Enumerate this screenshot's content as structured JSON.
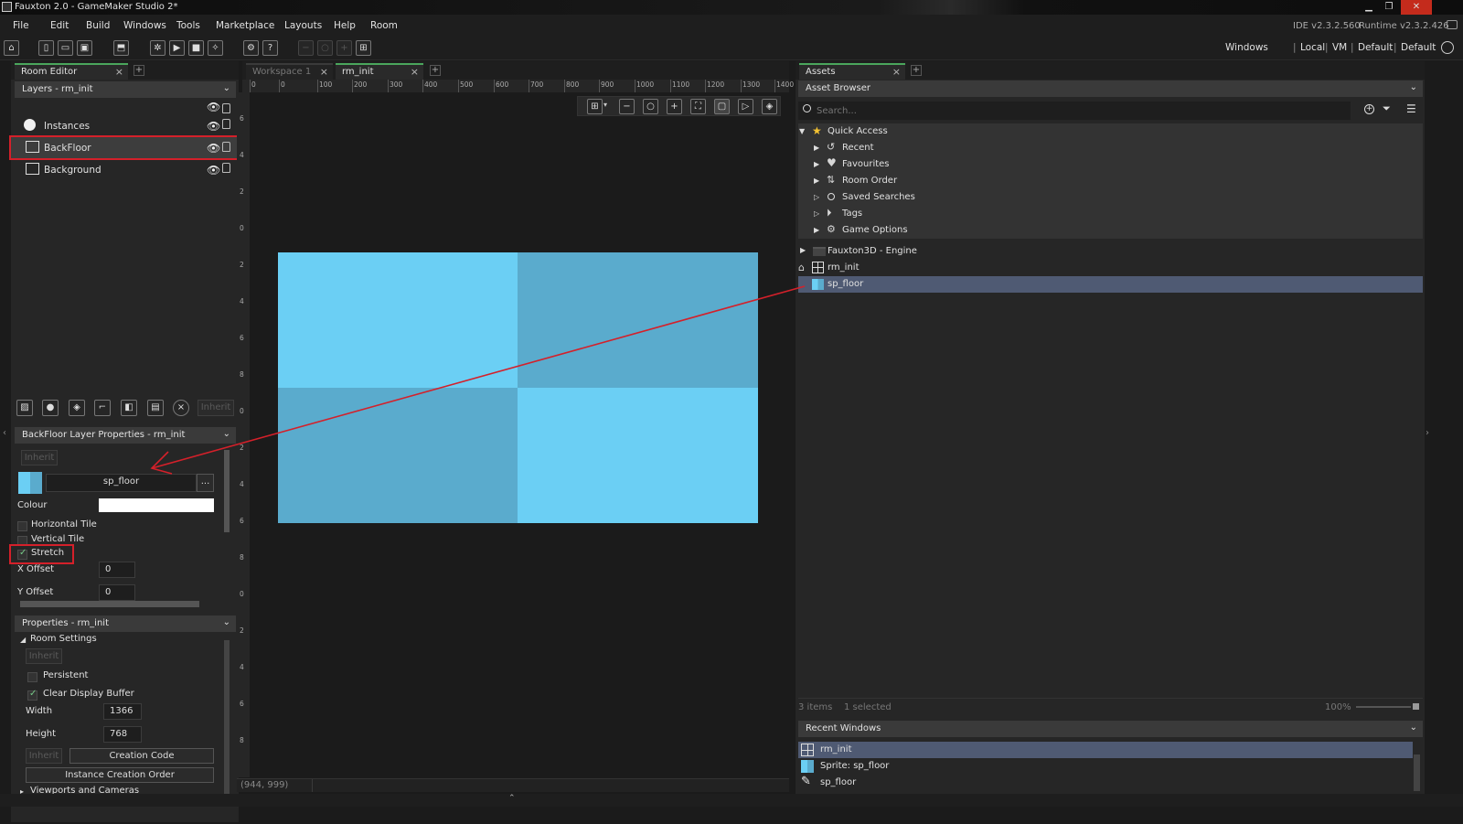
{
  "window": {
    "title": "Fauxton 2.0 - GameMaker Studio 2*"
  },
  "menu": [
    "File",
    "Edit",
    "Build",
    "Windows",
    "Tools",
    "Marketplace",
    "Layouts",
    "Help",
    "Room"
  ],
  "versions": {
    "ide": "IDE v2.3.2.560",
    "runtime": "Runtime v2.3.2.426"
  },
  "targets": [
    "Windows",
    "Local",
    "VM",
    "Default",
    "Default"
  ],
  "separator": "|",
  "room_editor": {
    "tab": "Room Editor",
    "layers_header": "Layers - rm_init",
    "layers": [
      {
        "name": "Instances",
        "icon": "instance-layer-icon"
      },
      {
        "name": "BackFloor",
        "icon": "background-layer-icon",
        "selected": true
      },
      {
        "name": "Background",
        "icon": "background-layer-icon"
      }
    ],
    "inherit_label": "Inherit",
    "layer_props": {
      "header": "BackFloor Layer Properties - rm_init",
      "inherit": "Inherit",
      "sprite": "sp_floor",
      "sprite_btn": "...",
      "colour_label": "Colour",
      "colour": "#ffffff",
      "horizontal_tile": "Horizontal Tile",
      "vertical_tile": "Vertical Tile",
      "stretch": "Stretch",
      "x_offset_label": "X Offset",
      "x_offset": "0",
      "y_offset_label": "Y Offset",
      "y_offset": "0"
    },
    "room_props": {
      "header": "Properties - rm_init",
      "section": "Room Settings",
      "inherit": "Inherit",
      "persistent": "Persistent",
      "clear_display": "Clear Display Buffer",
      "width_label": "Width",
      "width": "1366",
      "height_label": "Height",
      "height": "768",
      "inherit2": "Inherit",
      "creation_code": "Creation Code",
      "instance_order": "Instance Creation Order",
      "viewports": "Viewports and Cameras"
    }
  },
  "workspace": {
    "tabs": [
      {
        "label": "Workspace 1",
        "active": false
      },
      {
        "label": "rm_init",
        "active": true
      }
    ],
    "ruler": [
      "0",
      "0",
      "100",
      "200",
      "300",
      "400",
      "500",
      "600",
      "700",
      "800",
      "900",
      "1000",
      "1100",
      "1200",
      "1300",
      "1400"
    ],
    "vruler": [
      "6",
      "4",
      "2",
      "0",
      "2",
      "4",
      "6",
      "8",
      "0",
      "2",
      "4",
      "6",
      "8",
      "0",
      "2",
      "4",
      "6",
      "8"
    ],
    "coords": "(944, 999)"
  },
  "assets": {
    "tab": "Assets",
    "header": "Asset Browser",
    "search_placeholder": "Search...",
    "quick_access": "Quick Access",
    "quick_items": [
      {
        "label": "Recent",
        "icon": "history-icon"
      },
      {
        "label": "Favourites",
        "icon": "heart-icon"
      },
      {
        "label": "Room Order",
        "icon": "room-order-icon"
      },
      {
        "label": "Saved Searches",
        "icon": "search-icon"
      },
      {
        "label": "Tags",
        "icon": "tag-icon"
      },
      {
        "label": "Game Options",
        "icon": "gear-icon"
      }
    ],
    "tree": [
      {
        "label": "Fauxton3D - Engine",
        "icon": "folder-icon"
      },
      {
        "label": "rm_init",
        "icon": "room-icon"
      },
      {
        "label": "sp_floor",
        "icon": "sprite-icon",
        "selected": true
      }
    ],
    "status_items": "3 items",
    "status_selected": "1 selected",
    "zoom": "100%"
  },
  "recent_windows": {
    "header": "Recent Windows",
    "items": [
      {
        "label": "rm_init",
        "icon": "room-icon",
        "selected": true
      },
      {
        "label": "Sprite: sp_floor",
        "icon": "sprite-icon"
      },
      {
        "label": "sp_floor",
        "icon": "brush-icon"
      }
    ]
  },
  "colors": {
    "accent": "#4aa65c",
    "floor_light": "#6bcff4",
    "floor_dark": "#5aabcd",
    "annotation": "#d4202a"
  }
}
